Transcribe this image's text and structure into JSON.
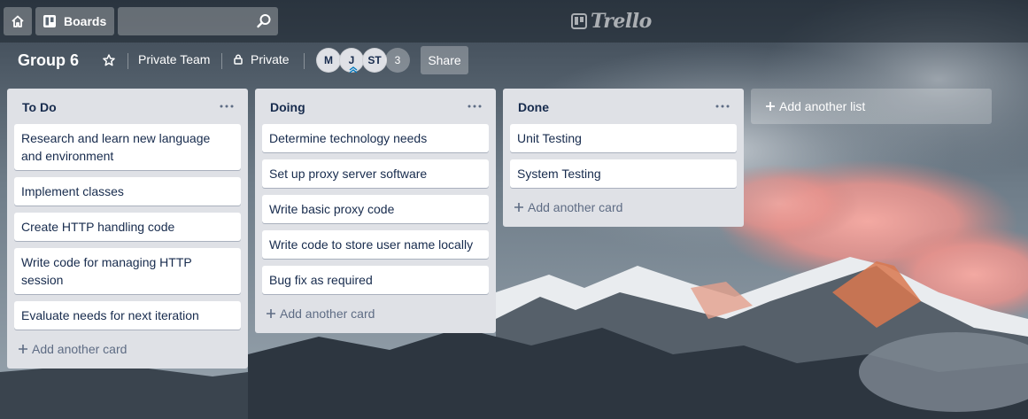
{
  "topbar": {
    "boards_label": "Boards",
    "search": {
      "value": "",
      "placeholder": ""
    },
    "logo_text": "Trello"
  },
  "board": {
    "title": "Group 6",
    "team_label": "Private Team",
    "visibility_label": "Private",
    "members": [
      "M",
      "J",
      "ST"
    ],
    "more_members": "3",
    "share_label": "Share"
  },
  "lists": [
    {
      "title": "To Do",
      "cards": [
        "Research and learn new language and environment",
        "Implement classes",
        "Create HTTP handling code",
        "Write code for managing HTTP session",
        "Evaluate needs for next iteration"
      ],
      "add_card_label": "Add another card"
    },
    {
      "title": "Doing",
      "cards": [
        "Determine technology needs",
        "Set up proxy server software",
        "Write basic proxy code",
        "Write code to store user name locally",
        "Bug fix as required"
      ],
      "add_card_label": "Add another card"
    },
    {
      "title": "Done",
      "cards": [
        "Unit Testing",
        "System Testing"
      ],
      "add_card_label": "Add another card"
    }
  ],
  "add_list_label": "Add another list",
  "icons": {
    "home": "home-icon",
    "boards": "boards-icon",
    "search": "search-icon",
    "star": "star-icon",
    "lock": "lock-icon",
    "menu": "ellipsis-icon",
    "plus": "plus-icon"
  },
  "colors": {
    "list_bg": "#dfe1e6",
    "card_bg": "#ffffff",
    "text": "#172b4d",
    "muted_text": "#5e6c84"
  }
}
